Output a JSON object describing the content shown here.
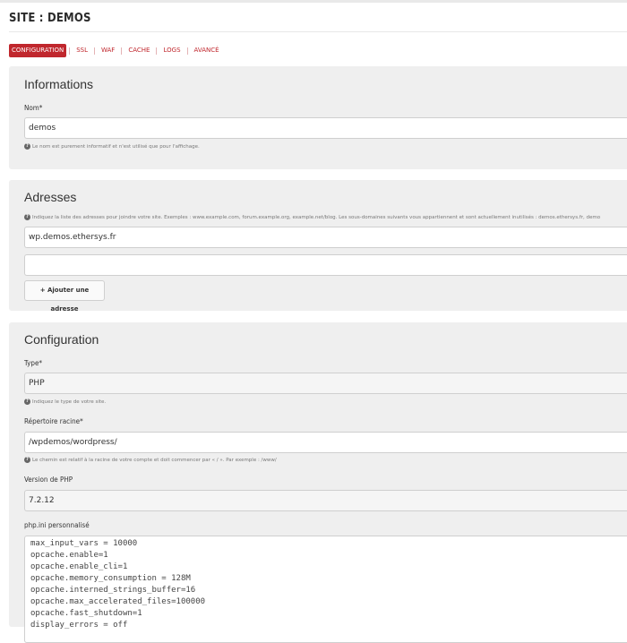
{
  "page": {
    "title": "SITE : DEMOS"
  },
  "tabs": [
    {
      "label": "CONFIGURATION",
      "active": true
    },
    {
      "label": "SSL",
      "active": false
    },
    {
      "label": "WAF",
      "active": false
    },
    {
      "label": "CACHE",
      "active": false
    },
    {
      "label": "LOGS",
      "active": false
    },
    {
      "label": "AVANCÉ",
      "active": false
    }
  ],
  "informations": {
    "title": "Informations",
    "nom_label": "Nom*",
    "nom_value": "demos",
    "nom_help": "Le nom est purement informatif et n'est utilisé que pour l'affichage."
  },
  "adresses": {
    "title": "Adresses",
    "help": "Indiquez la liste des adresses pour joindre votre site. Exemples : www.example.com, forum.example.org, example.net/blog. Les sous-domaines suivants vous appartiennent et sont actuellement inutilisés : demos.ethersys.fr, demo",
    "address_1": "wp.demos.ethersys.fr",
    "address_2": "",
    "add_button": "+ Ajouter une adresse"
  },
  "configuration": {
    "title": "Configuration",
    "type_label": "Type*",
    "type_value": "PHP",
    "type_help": "Indiquez le type de votre site.",
    "root_label": "Répertoire racine*",
    "root_value": "/wpdemos/wordpress/",
    "root_help": "Le chemin est relatif à la racine de votre compte et doit commencer par « / ». Par exemple : /www/",
    "php_version_label": "Version de PHP",
    "php_version_value": "7.2.12",
    "phpini_label": "php.ini personnalisé",
    "phpini_lines": [
      "max_input_vars = 10000",
      "opcache.enable=1",
      "opcache.enable_cli=1",
      "opcache.memory_consumption = 128M",
      "opcache.interned_strings_buffer=16",
      "opcache.max_accelerated_files=100000",
      "opcache.fast_shutdown=1",
      "display_errors = off"
    ]
  },
  "colors": {
    "accent": "#c0272d",
    "panel_bg": "#efefef"
  },
  "icons": {
    "help": "question-circle-icon"
  }
}
